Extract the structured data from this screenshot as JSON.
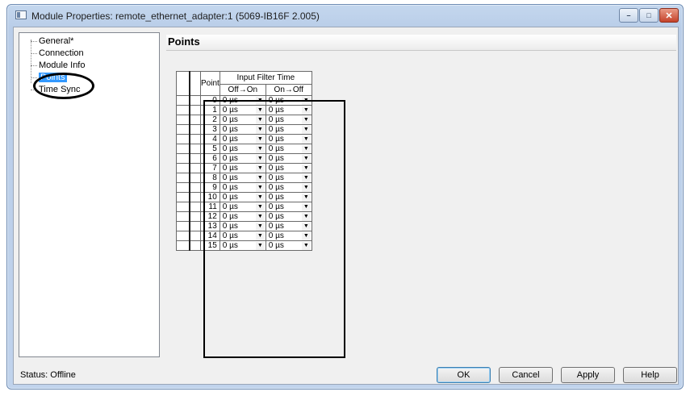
{
  "window": {
    "title": "Module Properties: remote_ethernet_adapter:1 (5069-IB16F 2.005)",
    "min_label": "–",
    "max_label": "□",
    "close_label": "✕"
  },
  "tree": {
    "items": [
      {
        "label": "General*",
        "selected": false
      },
      {
        "label": "Connection",
        "selected": false
      },
      {
        "label": "Module Info",
        "selected": false
      },
      {
        "label": "Points",
        "selected": true
      },
      {
        "label": "Time Sync",
        "selected": false
      }
    ]
  },
  "panel": {
    "title": "Points"
  },
  "grid": {
    "point_header": "Point",
    "group_header": "Input Filter Time",
    "col_off_on": "Off→On",
    "col_on_off": "On→Off",
    "rows": [
      {
        "point": "0",
        "off_on": "0 µs",
        "on_off": "0 µs"
      },
      {
        "point": "1",
        "off_on": "0 µs",
        "on_off": "0 µs"
      },
      {
        "point": "2",
        "off_on": "0 µs",
        "on_off": "0 µs"
      },
      {
        "point": "3",
        "off_on": "0 µs",
        "on_off": "0 µs"
      },
      {
        "point": "4",
        "off_on": "0 µs",
        "on_off": "0 µs"
      },
      {
        "point": "5",
        "off_on": "0 µs",
        "on_off": "0 µs"
      },
      {
        "point": "6",
        "off_on": "0 µs",
        "on_off": "0 µs"
      },
      {
        "point": "7",
        "off_on": "0 µs",
        "on_off": "0 µs"
      },
      {
        "point": "8",
        "off_on": "0 µs",
        "on_off": "0 µs"
      },
      {
        "point": "9",
        "off_on": "0 µs",
        "on_off": "0 µs"
      },
      {
        "point": "10",
        "off_on": "0 µs",
        "on_off": "0 µs"
      },
      {
        "point": "11",
        "off_on": "0 µs",
        "on_off": "0 µs"
      },
      {
        "point": "12",
        "off_on": "0 µs",
        "on_off": "0 µs"
      },
      {
        "point": "13",
        "off_on": "0 µs",
        "on_off": "0 µs"
      },
      {
        "point": "14",
        "off_on": "0 µs",
        "on_off": "0 µs"
      },
      {
        "point": "15",
        "off_on": "0 µs",
        "on_off": "0 µs"
      }
    ]
  },
  "status": {
    "text": "Status:  Offline"
  },
  "buttons": {
    "ok": "OK",
    "cancel": "Cancel",
    "apply": "Apply",
    "help": "Help"
  }
}
